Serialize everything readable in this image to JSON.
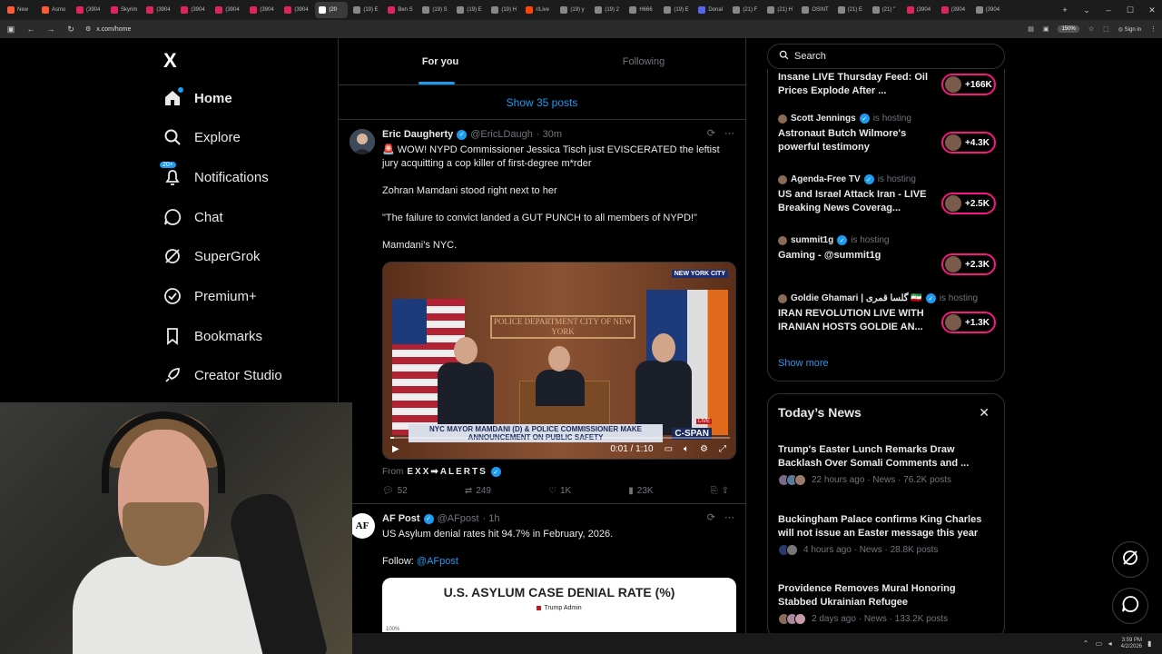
{
  "browser": {
    "tabs": [
      {
        "label": "New",
        "color": "#ff5a36"
      },
      {
        "label": "Asmo",
        "color": "#ff5a36"
      },
      {
        "label": "(3904",
        "color": "#e0245e"
      },
      {
        "label": "Skyrim",
        "color": "#e0245e"
      },
      {
        "label": "(3904",
        "color": "#e0245e"
      },
      {
        "label": "(3904",
        "color": "#e0245e"
      },
      {
        "label": "(3904",
        "color": "#e0245e"
      },
      {
        "label": "(3904",
        "color": "#e0245e"
      },
      {
        "label": "(3904",
        "color": "#e0245e"
      },
      {
        "label": "(20",
        "color": "#ffffff",
        "active": true
      },
      {
        "label": "(19) E",
        "color": "#888888"
      },
      {
        "label": "Ben S",
        "color": "#e0245e"
      },
      {
        "label": "(19) S",
        "color": "#888888"
      },
      {
        "label": "(19) E",
        "color": "#888888"
      },
      {
        "label": "(19) H",
        "color": "#888888"
      },
      {
        "label": "r/Live",
        "color": "#ff4500"
      },
      {
        "label": "(19) y",
        "color": "#888888"
      },
      {
        "label": "(19) 2",
        "color": "#888888"
      },
      {
        "label": "H666",
        "color": "#888888"
      },
      {
        "label": "(19) E",
        "color": "#888888"
      },
      {
        "label": "Donal",
        "color": "#5865f2"
      },
      {
        "label": "(21) F",
        "color": "#888888"
      },
      {
        "label": "(21) H",
        "color": "#888888"
      },
      {
        "label": "OSINT",
        "color": "#888888"
      },
      {
        "label": "(21) E",
        "color": "#888888"
      },
      {
        "label": "(21) \"",
        "color": "#888888"
      },
      {
        "label": "(3904",
        "color": "#e0245e"
      },
      {
        "label": "(3904",
        "color": "#e0245e"
      },
      {
        "label": "(3904",
        "color": "#888888"
      }
    ],
    "url": "x.com/home",
    "zoom": "150%",
    "signin": "Sign in"
  },
  "nav": {
    "logo": "X",
    "items": [
      {
        "label": "Home",
        "icon": "home-icon"
      },
      {
        "label": "Explore",
        "icon": "search-icon"
      },
      {
        "label": "Notifications",
        "icon": "bell-icon",
        "badge": "20+"
      },
      {
        "label": "Chat",
        "icon": "chat-icon"
      },
      {
        "label": "SuperGrok",
        "icon": "grok-icon"
      },
      {
        "label": "Premium+",
        "icon": "premium-icon"
      },
      {
        "label": "Bookmarks",
        "icon": "bookmark-icon"
      },
      {
        "label": "Creator Studio",
        "icon": "rocket-icon"
      }
    ]
  },
  "feed": {
    "tab_for_you": "For you",
    "tab_following": "Following",
    "show_posts": "Show 35 posts",
    "post1": {
      "name": "Eric Daugherty",
      "handle": "@EricLDaugh",
      "time": "· 30m",
      "text": "🚨 WOW! NYPD Commissioner Jessica Tisch just EVISCERATED the leftist jury acquitting a cop killer of first-degree m*rder\n\nZohran Mamdani stood right next to her\n\n\"The failure to convict landed a GUT PUNCH to all members of NYPD!\"\n\nMamdani's NYC.",
      "video": {
        "sign": "POLICE DEPARTMENT CITY OF NEW YORK",
        "network_tag": "NEW YORK CITY",
        "caption": "NYC MAYOR MAMDANI (D) & POLICE COMMISSIONER MAKE ANNOUNCEMENT ON PUBLIC SAFETY",
        "live_label": "LIVE",
        "network": "C-SPAN",
        "time": "0:01 / 1:10",
        "progress": 0.01
      },
      "from_label": "From",
      "from_source": "EXX➡ALERTS",
      "replies": "52",
      "reposts": "249",
      "likes": "1K",
      "views": "23K"
    },
    "post2": {
      "avatar_text": "AF",
      "name": "AF Post",
      "handle": "@AFpost",
      "time": "· 1h",
      "text": "US Asylum denial rates hit 94.7% in February, 2026.",
      "follow_label": "Follow: ",
      "follow_link": "@AFpost",
      "card_title": "U.S. ASYLUM CASE DENIAL RATE (%)",
      "card_legend": "Trump Admin",
      "card_tick": "100%"
    }
  },
  "right": {
    "search_placeholder": "Search",
    "live": [
      {
        "host": "",
        "hosting": "",
        "title": "Insane LIVE Thursday Feed: Oil Prices Explode After ...",
        "count": "+166K"
      },
      {
        "host": "Scott Jennings",
        "hosting": "is hosting",
        "title": "Astronaut Butch Wilmore's powerful testimony",
        "count": "+4.3K"
      },
      {
        "host": "Agenda-Free TV",
        "hosting": "is hosting",
        "title": "US and Israel Attack Iran - LIVE Breaking News Coverag...",
        "count": "+2.5K"
      },
      {
        "host": "summit1g",
        "hosting": "is hosting",
        "title": "Gaming - @summit1g",
        "count": "+2.3K"
      },
      {
        "host": "Goldie Ghamari | گلسا قمری 🇮🇷",
        "hosting": "is hosting",
        "title": "IRAN REVOLUTION LIVE WITH IRANIAN HOSTS GOLDIE AN...",
        "count": "+1.3K"
      }
    ],
    "show_more": "Show more",
    "news_heading": "Today’s News",
    "news": [
      {
        "title": "Trump's Easter Lunch Remarks Draw Backlash Over Somali Comments and ...",
        "meta": "22 hours ago · News · 76.2K posts"
      },
      {
        "title": "Buckingham Palace confirms King Charles will not issue an Easter message this year",
        "meta": "4 hours ago · News · 28.8K posts"
      },
      {
        "title": "Providence Removes Mural Honoring Stabbed Ukrainian Refugee",
        "meta": "2 days ago · News · 133.2K posts"
      }
    ]
  },
  "taskbar": {
    "time": "3:59 PM",
    "date": "4/2/2026"
  }
}
